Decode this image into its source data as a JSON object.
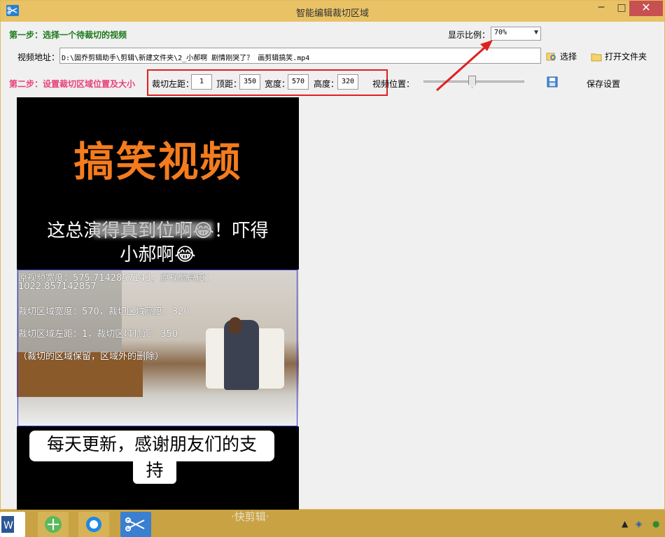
{
  "window": {
    "title": "智能编辑裁切区域",
    "min": "─",
    "max": "□",
    "close": "✕"
  },
  "step1": {
    "label": "第一步：选择一个待裁切的视频",
    "ratio_label": "显示比例：",
    "ratio_value": "70%"
  },
  "address": {
    "label": "视频地址：",
    "value": "D:\\固乔剪辑助手\\剪辑\\新建文件夹\\2_小郝啊  剧情刚哭了？ 画剪辑搞笑.mp4",
    "select_label": "选择",
    "open_folder_label": "打开文件夹"
  },
  "step2": {
    "label": "第二步：设置裁切区域位置及大小",
    "left_label": "裁切左距：",
    "left_value": "1",
    "top_label": "顶距：",
    "top_value": "350",
    "width_label": "宽度：",
    "width_value": "570",
    "height_label": "高度：",
    "height_value": "320",
    "position_label": "视频位置：",
    "save_label": "保存设置"
  },
  "video": {
    "title": "搞笑视频",
    "caption_line1": "这总演得真到位啊😂！吓得",
    "caption_line2": "小郝啊😂",
    "info_line1": "原视频宽度：575.7142857143，原视频高度：",
    "info_line2": "1022.857142857",
    "info_line3": "裁切区域宽度：570，裁切区域高度：320",
    "info_line4": "裁切区域左距：1，裁切区域顶距：350",
    "info_line5": "（裁切的区域保留，区域外的删除）",
    "bottom_line1": "每天更新，感谢朋友们的支",
    "bottom_line2": "持",
    "watermark": "·快剪辑·"
  },
  "colors": {
    "step1": "#1c7a1c",
    "step2": "#e8427a",
    "highlight": "#e02020",
    "title_orange": "#f47c1e"
  }
}
